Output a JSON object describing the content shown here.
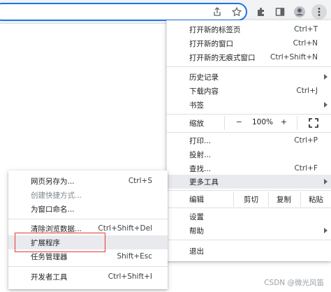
{
  "menu": {
    "items": [
      {
        "label": "打开新的标签页",
        "shortcut": "Ctrl+T"
      },
      {
        "label": "打开新的窗口",
        "shortcut": "Ctrl+N"
      },
      {
        "label": "打开新的无痕式窗口",
        "shortcut": "Ctrl+Shift+N"
      },
      {
        "label": "历史记录",
        "shortcut": ""
      },
      {
        "label": "下载内容",
        "shortcut": "Ctrl+J"
      },
      {
        "label": "书签",
        "shortcut": ""
      },
      {
        "label": "打印...",
        "shortcut": "Ctrl+P"
      },
      {
        "label": "投射...",
        "shortcut": ""
      },
      {
        "label": "查找...",
        "shortcut": "Ctrl+F"
      },
      {
        "label": "更多工具",
        "shortcut": ""
      },
      {
        "label": "设置",
        "shortcut": ""
      },
      {
        "label": "帮助",
        "shortcut": ""
      },
      {
        "label": "退出",
        "shortcut": ""
      }
    ],
    "zoom": {
      "label": "缩放",
      "minus": "−",
      "value": "100%",
      "plus": "+"
    },
    "edit": {
      "label": "编辑",
      "cut": "剪切",
      "copy": "复制",
      "paste": "粘贴"
    }
  },
  "submenu": {
    "items": [
      {
        "label": "网页另存为...",
        "shortcut": "Ctrl+S"
      },
      {
        "label": "创建快捷方式...",
        "shortcut": ""
      },
      {
        "label": "为窗口命名...",
        "shortcut": ""
      },
      {
        "label": "清除浏览数据...",
        "shortcut": "Ctrl+Shift+Del"
      },
      {
        "label": "扩展程序",
        "shortcut": ""
      },
      {
        "label": "任务管理器",
        "shortcut": "Shift+Esc"
      },
      {
        "label": "开发者工具",
        "shortcut": "Ctrl+Shift+I"
      }
    ]
  },
  "watermark": "CSDN @微光风笛",
  "icons": {
    "share": "share-icon",
    "bookmark": "star-icon",
    "extensions": "puzzle-icon",
    "sidepanel": "side-panel-icon",
    "profile": "profile-icon",
    "menu": "kebab-menu-icon"
  },
  "colors": {
    "accent": "#1a73e8",
    "highlight": "#e8eaed",
    "annotation": "#e53935"
  }
}
